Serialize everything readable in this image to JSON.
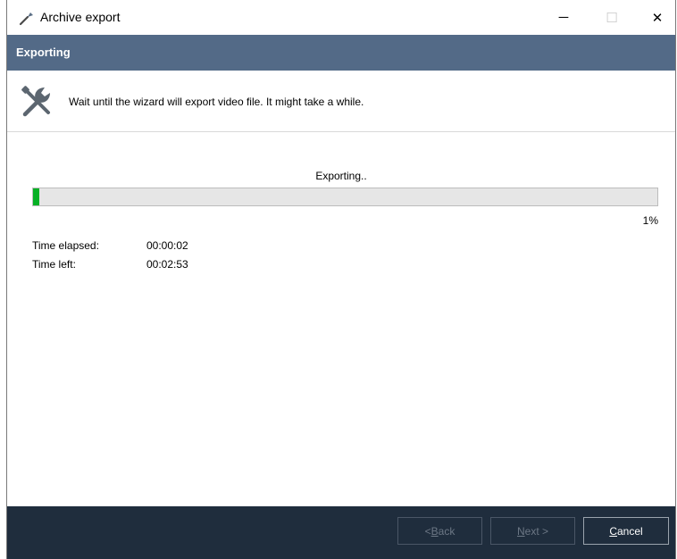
{
  "window": {
    "title": "Archive export",
    "icon": "wrench-icon",
    "controls": {
      "minimize": "─",
      "maximize": "☐",
      "close": "✕"
    }
  },
  "header": {
    "title": "Exporting"
  },
  "intro": {
    "icon": "tools-icon",
    "text": "Wait until the wizard will export video file. It might take a while."
  },
  "progress": {
    "status": "Exporting..",
    "percent_label": "1%",
    "value": 0.01,
    "color": "#06b025"
  },
  "stats": {
    "elapsed_label": "Time elapsed:",
    "elapsed_value": "00:00:02",
    "left_label": "Time left:",
    "left_value": "00:02:53"
  },
  "footer": {
    "back_prefix": "< ",
    "back_key": "B",
    "back_rest": "ack",
    "next_key": "N",
    "next_rest": "ext >",
    "cancel_key": "C",
    "cancel_rest": "ancel"
  },
  "colors": {
    "header_band": "#536a87",
    "footer_band": "#1f2d3d"
  }
}
